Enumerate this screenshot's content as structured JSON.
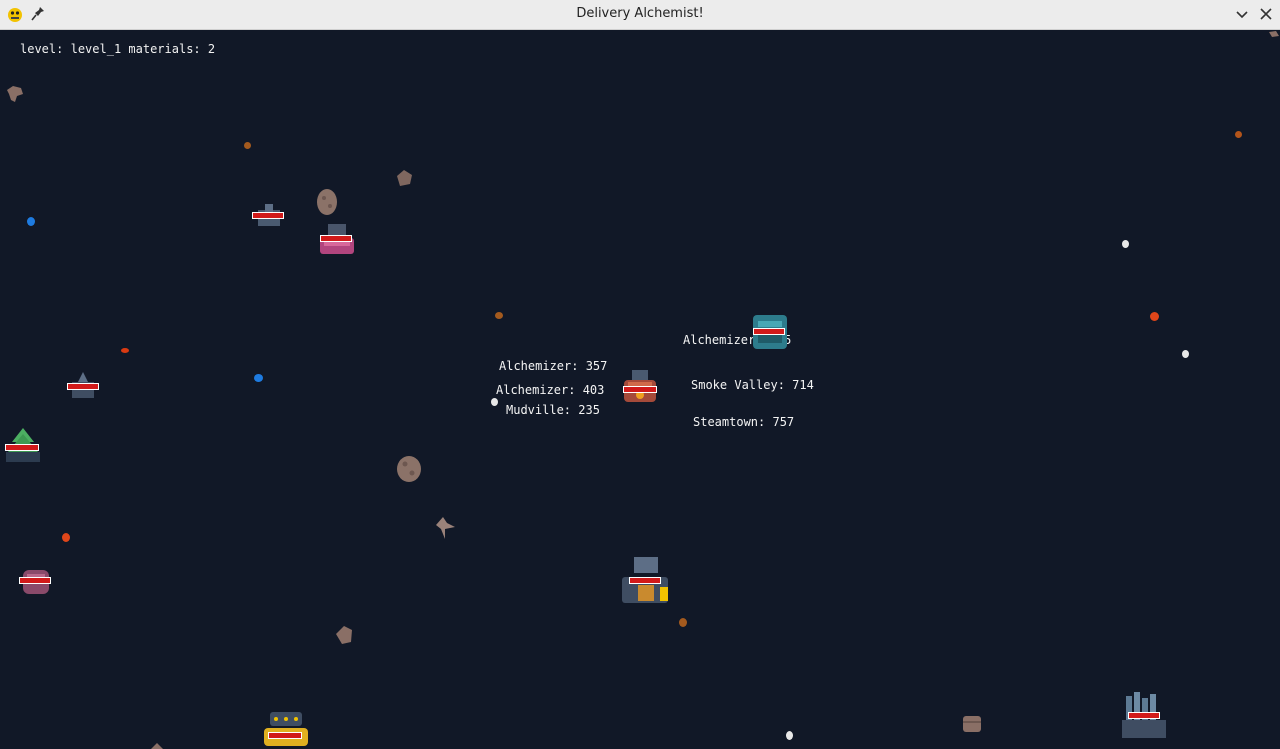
{
  "window": {
    "title": "Delivery Alchemist!"
  },
  "hud": {
    "level_label": "level:",
    "level_value": "level_1",
    "materials_label": "materials:",
    "materials_value": "2"
  },
  "labels": {
    "alchemizer_357": "Alchemizer: 357",
    "alchemizer_403": "Alchemizer: 403",
    "mudville": "Mudville: 235",
    "alchemizer_545": "Alchemizer: 545",
    "smoke_valley": "Smoke Valley: 714",
    "steamtown": "Steamtown: 757"
  },
  "colors": {
    "background": "#111827",
    "health_bar": "#d11a1a",
    "titlebar": "#ececec"
  }
}
